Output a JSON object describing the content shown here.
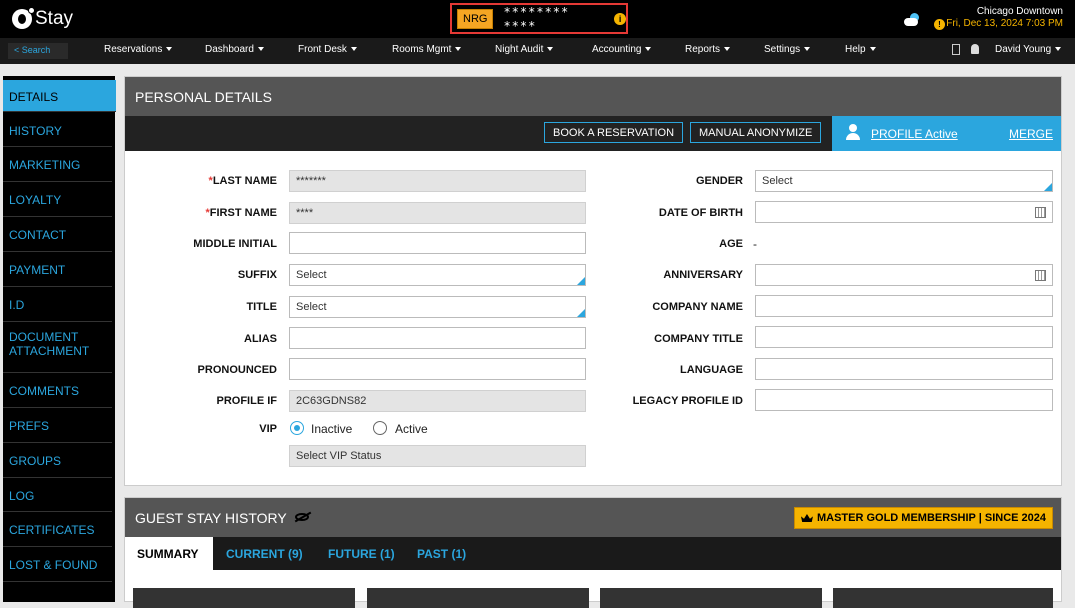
{
  "topbar": {
    "logo_text": "Stay",
    "property_code": "NRG",
    "masked_name": "******** ****",
    "info_glyph": "i",
    "location": "Chicago Downtown",
    "datetime": "Fri, Dec 13, 2024 7:03 PM",
    "warning_glyph": "!"
  },
  "nav": {
    "search_label": "< Search",
    "items": [
      "Reservations",
      "Dashboard",
      "Front Desk",
      "Rooms Mgmt",
      "Night Audit",
      "Accounting",
      "Reports",
      "Settings",
      "Help"
    ],
    "user": "David Young"
  },
  "sidebar": {
    "items": [
      "DETAILS",
      "HISTORY",
      "MARKETING",
      "LOYALTY",
      "CONTACT",
      "PAYMENT",
      "I.D",
      "DOCUMENT ATTACHMENT",
      "COMMENTS",
      "PREFS",
      "GROUPS",
      "LOG",
      "CERTIFICATES",
      "LOST & FOUND"
    ],
    "active": "DETAILS"
  },
  "personal": {
    "title": "PERSONAL DETAILS",
    "book_button": "BOOK A RESERVATION",
    "anonymize_button": "MANUAL ANONYMIZE",
    "profile_status": "PROFILE Active",
    "merge": "MERGE"
  },
  "form_left": {
    "last_name": {
      "label": "LAST NAME",
      "value": "*******"
    },
    "first_name": {
      "label": "FIRST NAME",
      "value": "****"
    },
    "middle_initial": {
      "label": "MIDDLE INITIAL",
      "value": ""
    },
    "suffix": {
      "label": "SUFFIX",
      "value": "Select"
    },
    "title": {
      "label": "TITLE",
      "value": "Select"
    },
    "alias": {
      "label": "ALIAS",
      "value": ""
    },
    "pronounced": {
      "label": "PRONOUNCED",
      "value": ""
    },
    "profile_if": {
      "label": "PROFILE IF",
      "value": "2C63GDNS82"
    },
    "vip": {
      "label": "VIP",
      "inactive": "Inactive",
      "active": "Active",
      "status_button": "Select VIP Status"
    }
  },
  "form_right": {
    "gender": {
      "label": "GENDER",
      "value": "Select"
    },
    "dob": {
      "label": "DATE OF BIRTH",
      "value": ""
    },
    "age": {
      "label": "AGE",
      "value": "-"
    },
    "anniversary": {
      "label": "ANNIVERSARY",
      "value": ""
    },
    "company_name": {
      "label": "COMPANY NAME",
      "value": ""
    },
    "company_title": {
      "label": "COMPANY TITLE",
      "value": ""
    },
    "language": {
      "label": "LANGUAGE",
      "value": ""
    },
    "legacy_id": {
      "label": "LEGACY PROFILE ID",
      "value": ""
    }
  },
  "guest_stay": {
    "title": "GUEST STAY HISTORY",
    "membership": "MASTER GOLD MEMBERSHIP | SINCE 2024",
    "tabs": [
      "SUMMARY",
      "CURRENT (9)",
      "FUTURE (1)",
      "PAST (1)"
    ]
  },
  "colors": {
    "accent": "#2ba6de",
    "gold": "#f5b400",
    "highlight_border": "#e53935"
  }
}
